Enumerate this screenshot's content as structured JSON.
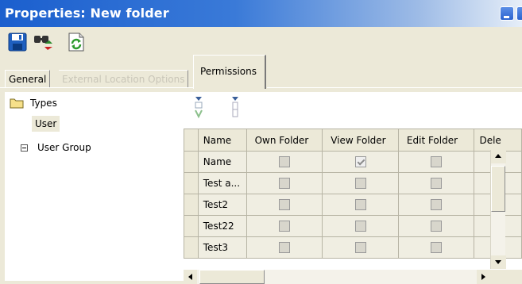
{
  "window": {
    "title": "Properties: New folder"
  },
  "toolbar": {
    "icons": [
      "save-icon",
      "find-replace-icon",
      "refresh-icon"
    ]
  },
  "tabs": [
    {
      "label": "General",
      "state": "inactive"
    },
    {
      "label": "External Location Options",
      "state": "disabled"
    },
    {
      "label": "Permissions",
      "state": "active"
    }
  ],
  "tree": {
    "root_label": "Types",
    "user_label": "User",
    "group_label": "User Group"
  },
  "grid": {
    "columns": [
      "Name",
      "Own Folder",
      "View Folder",
      "Edit Folder",
      "Dele"
    ],
    "rows": [
      {
        "name": "Name",
        "own": false,
        "view": true,
        "edit": false
      },
      {
        "name": "Test a...",
        "own": false,
        "view": false,
        "edit": false
      },
      {
        "name": "Test2",
        "own": false,
        "view": false,
        "edit": false
      },
      {
        "name": "Test22",
        "own": false,
        "view": false,
        "edit": false
      },
      {
        "name": "Test3",
        "own": false,
        "view": false,
        "edit": false
      }
    ]
  },
  "colors": {
    "titlebar_start": "#1b5fce",
    "window_bg": "#ece9d8",
    "disabled_text": "#c9c6b8"
  }
}
